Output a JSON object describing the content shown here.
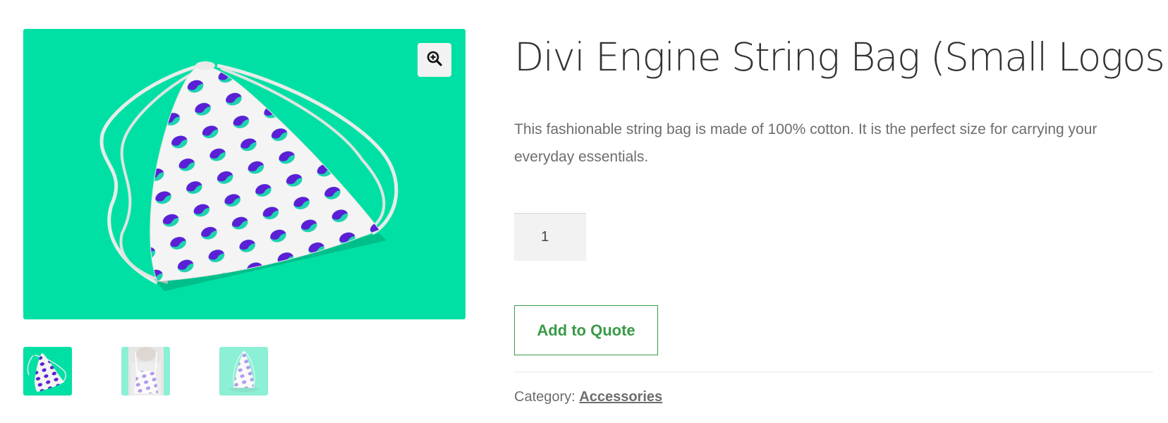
{
  "product": {
    "title": "Divi Engine String Bag (Small Logos)",
    "description": "This fashionable string bag is made of 100% cotton. It is the perfect size for carrying your everyday essentials.",
    "quantity": "1",
    "add_button_label": "Add to Quote",
    "category_label": "Category:",
    "category_link": "Accessories"
  },
  "gallery": {
    "main_image": "string-bag-image",
    "zoom_icon": "magnifier-plus-icon",
    "thumbnails": [
      {
        "name": "thumbnail-bag-flat",
        "active": true
      },
      {
        "name": "thumbnail-bag-worn",
        "active": false
      },
      {
        "name": "thumbnail-bag-standing",
        "active": false
      }
    ]
  },
  "colors": {
    "image_background": "#00e0a4",
    "accent_green": "#3a9a47",
    "logo_purple": "#5b1fd6",
    "logo_teal": "#1ed3b0"
  }
}
